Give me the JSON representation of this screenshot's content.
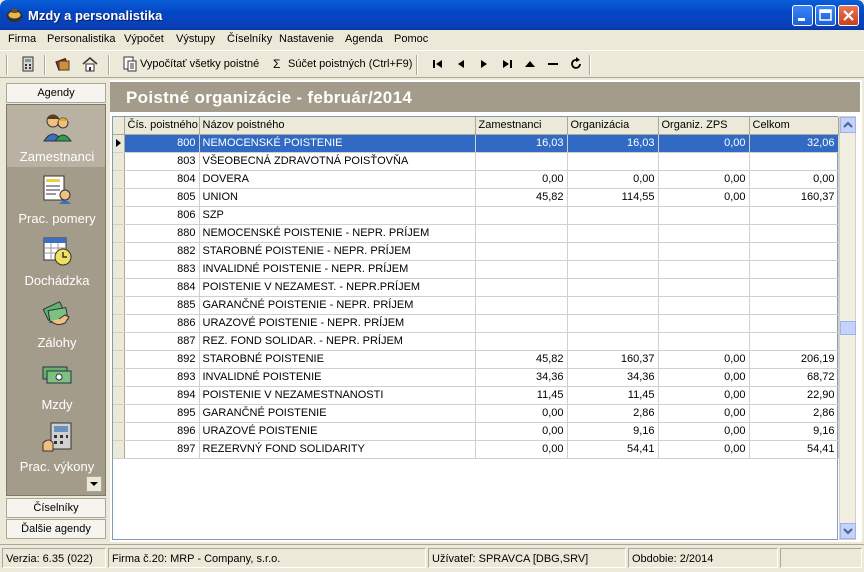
{
  "window": {
    "title": "Mzdy a personalistika",
    "icon": "app-icon",
    "buttons": [
      "minimize-icon",
      "maximize-icon",
      "close-icon"
    ]
  },
  "menu": [
    {
      "label": "Firma"
    },
    {
      "label": "Personalistika"
    },
    {
      "label": "Výpočet"
    },
    {
      "label": "Výstupy"
    },
    {
      "label": "Číselníky"
    },
    {
      "label": "Nastavenie"
    },
    {
      "label": "Agenda"
    },
    {
      "label": "Pomoc"
    }
  ],
  "toolbar": {
    "calc_all_label": "Vypočítať všetky poistné",
    "sum_label": "Súčet poistných (Ctrl+F9)",
    "sum_symbol": "Σ"
  },
  "sidebar": {
    "header": "Agendy",
    "items": [
      {
        "label": "Zamestnanci",
        "icon": "employees-icon"
      },
      {
        "label": "Prac. pomery",
        "icon": "contracts-icon"
      },
      {
        "label": "Dochádzka",
        "icon": "attendance-icon"
      },
      {
        "label": "Zálohy",
        "icon": "advances-icon"
      },
      {
        "label": "Mzdy",
        "icon": "wages-icon"
      },
      {
        "label": "Prac. výkony",
        "icon": "work-output-icon"
      }
    ],
    "bottom": [
      "Číselníky",
      "Ďalšie agendy"
    ]
  },
  "main": {
    "title": "Poistné organizácie - február/2014",
    "columns": [
      "Čís. poistného",
      "Názov poistného",
      "Zamestnanci",
      "Organizácia",
      "Organiz. ZPS",
      "Celkom"
    ],
    "selected_index": 0,
    "rows": [
      [
        "800",
        "NEMOCENSKÉ POISTENIE",
        "16,03",
        "16,03",
        "0,00",
        "32,06"
      ],
      [
        "803",
        "VŠEOBECNÁ ZDRAVOTNÁ POISŤOVŇA",
        "",
        "",
        "",
        ""
      ],
      [
        "804",
        "DOVERA",
        "0,00",
        "0,00",
        "0,00",
        "0,00"
      ],
      [
        "805",
        "UNION",
        "45,82",
        "114,55",
        "0,00",
        "160,37"
      ],
      [
        "806",
        "SZP",
        "",
        "",
        "",
        ""
      ],
      [
        "880",
        "NEMOCENSKÉ POISTENIE - NEPR. PRÍJEM",
        "",
        "",
        "",
        ""
      ],
      [
        "882",
        "STAROBNÉ POISTENIE - NEPR. PRÍJEM",
        "",
        "",
        "",
        ""
      ],
      [
        "883",
        "INVALIDNÉ POISTENIE - NEPR. PRÍJEM",
        "",
        "",
        "",
        ""
      ],
      [
        "884",
        "POISTENIE V NEZAMEST. - NEPR.PRÍJEM",
        "",
        "",
        "",
        ""
      ],
      [
        "885",
        "GARANČNÉ POISTENIE - NEPR. PRÍJEM",
        "",
        "",
        "",
        ""
      ],
      [
        "886",
        "URAZOVÉ POISTENIE - NEPR. PRÍJEM",
        "",
        "",
        "",
        ""
      ],
      [
        "887",
        "REZ. FOND SOLIDAR. - NEPR. PRÍJEM",
        "",
        "",
        "",
        ""
      ],
      [
        "892",
        "STAROBNÉ POISTENIE",
        "45,82",
        "160,37",
        "0,00",
        "206,19"
      ],
      [
        "893",
        "INVALIDNÉ POISTENIE",
        "34,36",
        "34,36",
        "0,00",
        "68,72"
      ],
      [
        "894",
        "POISTENIE V NEZAMESTNANOSTI",
        "11,45",
        "11,45",
        "0,00",
        "22,90"
      ],
      [
        "895",
        "GARANČNÉ POISTENIE",
        "0,00",
        "2,86",
        "0,00",
        "2,86"
      ],
      [
        "896",
        "URAZOVÉ POISTENIE",
        "0,00",
        "9,16",
        "0,00",
        "9,16"
      ],
      [
        "897",
        "REZERVNÝ FOND SOLIDARITY",
        "0,00",
        "54,41",
        "0,00",
        "54,41"
      ]
    ]
  },
  "status": {
    "version": "Verzia: 6.35 (022)",
    "company": "Firma č.20: MRP - Company, s.r.o.",
    "user": "Užívateľ: SPRAVCA [DBG,SRV]",
    "period": "Obdobie: 2/2014"
  },
  "colors": {
    "titlebar": "#0447c6",
    "selection": "#316ac5",
    "header_band": "#a49c8b"
  }
}
